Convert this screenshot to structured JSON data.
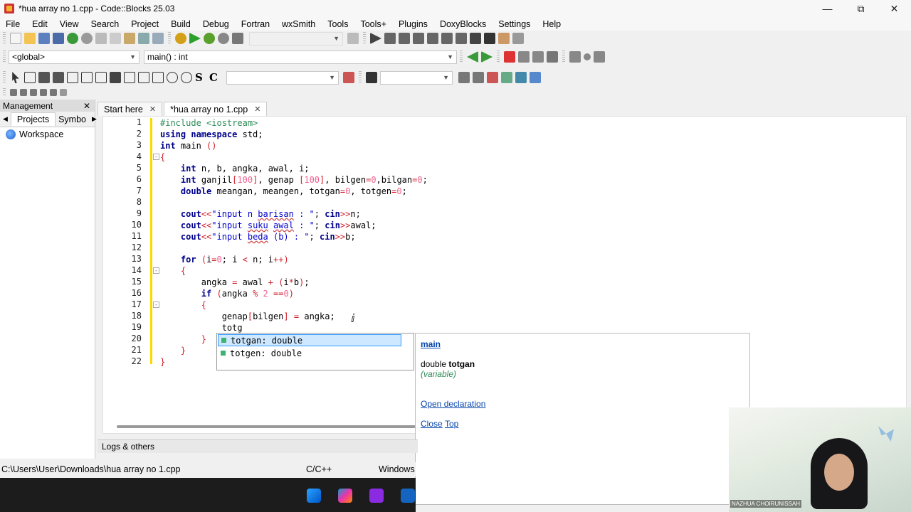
{
  "window": {
    "title": "*hua array no 1.cpp - Code::Blocks 25.03"
  },
  "menu": [
    "File",
    "Edit",
    "View",
    "Search",
    "Project",
    "Build",
    "Debug",
    "Fortran",
    "wxSmith",
    "Tools",
    "Tools+",
    "Plugins",
    "DoxyBlocks",
    "Settings",
    "Help"
  ],
  "scope": {
    "global": "<global>",
    "function": "main() : int"
  },
  "management": {
    "title": "Management",
    "tabs": [
      "Projects",
      "Symbo"
    ],
    "workspace": "Workspace"
  },
  "editor_tabs": [
    {
      "label": "Start here"
    },
    {
      "label": "*hua array no 1.cpp"
    }
  ],
  "code_lines": [
    {
      "n": "1",
      "html": "<span class='pp'>#include &lt;iostream&gt;</span>"
    },
    {
      "n": "2",
      "html": "<span class='kw'>using namespace</span> std;"
    },
    {
      "n": "3",
      "html": "<span class='kw'>int</span> main <span class='op'>()</span>"
    },
    {
      "n": "4",
      "html": "<span class='op'>{</span>"
    },
    {
      "n": "5",
      "html": "    <span class='kw'>int</span> n, b, angka, awal, i;"
    },
    {
      "n": "6",
      "html": "    <span class='kw'>int</span> ganjil<span class='op'>[</span><span class='num'>100</span><span class='op'>]</span>, genap <span class='op'>[</span><span class='num'>100</span><span class='op'>]</span>, bilgen<span class='op'>=</span><span class='num'>0</span>,bilgan<span class='op'>=</span><span class='num'>0</span>;"
    },
    {
      "n": "7",
      "html": "    <span class='kw'>double</span> meangan, meangen, totgan<span class='op'>=</span><span class='num'>0</span>, totgen<span class='op'>=</span><span class='num'>0</span>;"
    },
    {
      "n": "8",
      "html": ""
    },
    {
      "n": "9",
      "html": "    <span class='kw'>cout</span><span class='op'>&lt;&lt;</span><span class='str'>\"input n <span class='ul'>barisan</span> : \"</span>; <span class='kw'>cin</span><span class='op'>&gt;&gt;</span>n;"
    },
    {
      "n": "10",
      "html": "    <span class='kw'>cout</span><span class='op'>&lt;&lt;</span><span class='str'>\"input <span class='ul'>suku</span> <span class='ul'>awal</span> : \"</span>; <span class='kw'>cin</span><span class='op'>&gt;&gt;</span>awal;"
    },
    {
      "n": "11",
      "html": "    <span class='kw'>cout</span><span class='op'>&lt;&lt;</span><span class='str'>\"input <span class='ul'>beda</span> (b) : \"</span>; <span class='kw'>cin</span><span class='op'>&gt;&gt;</span>b;"
    },
    {
      "n": "12",
      "html": ""
    },
    {
      "n": "13",
      "html": "    <span class='kw'>for</span> <span class='op'>(</span>i<span class='op'>=</span><span class='num'>0</span>; i <span class='op'>&lt;</span> n; i<span class='op'>++)</span>"
    },
    {
      "n": "14",
      "html": "    <span class='op'>{</span>"
    },
    {
      "n": "15",
      "html": "        angka <span class='op'>=</span> awal <span class='op'>+ (</span>i<span class='op'>*</span>b<span class='op'>)</span>;"
    },
    {
      "n": "16",
      "html": "        <span class='kw'>if</span> <span class='op'>(</span>angka <span class='op'>%</span> <span class='num'>2</span> <span class='op'>==</span><span class='num'>0</span><span class='op'>)</span>"
    },
    {
      "n": "17",
      "html": "        <span class='op'>{</span>"
    },
    {
      "n": "18",
      "html": "            genap<span class='op'>[</span>bilgen<span class='op'>]</span> <span class='op'>=</span> angka;"
    },
    {
      "n": "19",
      "html": "            totg"
    },
    {
      "n": "20",
      "html": "        <span class='op'>}</span>"
    },
    {
      "n": "21",
      "html": "    <span class='op'>}</span>"
    },
    {
      "n": "22",
      "html": "<span class='op'>}</span>"
    }
  ],
  "autocomplete": [
    "totgan: double",
    "totgen: double"
  ],
  "doc_popup": {
    "scope": "main",
    "type": "double",
    "name": "totgan",
    "kind": "(variable)",
    "open_decl": "Open declaration",
    "close": "Close",
    "top": "Top"
  },
  "logs_label": "Logs & others",
  "status": {
    "path": "C:\\Users\\User\\Downloads\\hua array no 1.cpp",
    "language": "C/C++",
    "eol": "Windows"
  },
  "webcam": {
    "caption": "NAZHUA CHOIRUNISSAH"
  },
  "colors": {
    "keyword": "#00008b",
    "preprocessor": "#2e8b57",
    "number": "#f06292",
    "string": "#0000cd",
    "operator": "#d0202c",
    "changebar": "#ffd800",
    "selection": "#cde8ff"
  }
}
